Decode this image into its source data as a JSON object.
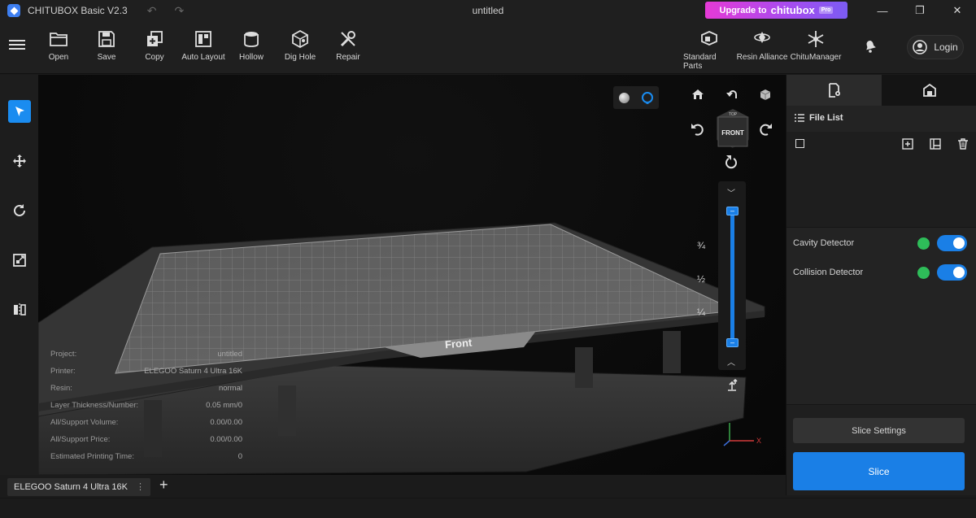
{
  "app": {
    "title": "CHITUBOX Basic V2.3",
    "window_title": "untitled"
  },
  "upgrade": {
    "prefix": "Upgrade to",
    "brand": "chitubox",
    "tag": "Pro"
  },
  "toolbar": {
    "open": "Open",
    "save": "Save",
    "copy": "Copy",
    "auto_layout": "Auto Layout",
    "hollow": "Hollow",
    "dig_hole": "Dig Hole",
    "repair": "Repair",
    "standard_parts": "Standard Parts",
    "resin_alliance": "Resin Alliance",
    "chitu_manager": "ChituManager",
    "login": "Login"
  },
  "left_tools": [
    "select",
    "move",
    "rotate",
    "scale",
    "mirror"
  ],
  "viewport": {
    "plate_label": "Front",
    "nav_cube_top": "TOP",
    "nav_cube_front": "FRONT",
    "slider_marks": [
      "¾",
      "½",
      "¼"
    ],
    "axis_x": "X"
  },
  "project_info": [
    {
      "label": "Project:",
      "value": "untitled"
    },
    {
      "label": "Printer:",
      "value": "ELEGOO Saturn 4 Ultra 16K"
    },
    {
      "label": "Resin:",
      "value": "normal"
    },
    {
      "label": "Layer Thickness/Number:",
      "value": "0.05 mm/0"
    },
    {
      "label": "All/Support Volume:",
      "value": "0.00/0.00"
    },
    {
      "label": "All/Support Price:",
      "value": "0.00/0.00"
    },
    {
      "label": "Estimated Printing Time:",
      "value": "0"
    }
  ],
  "right_panel": {
    "file_list": "File List",
    "cavity_detector": "Cavity Detector",
    "collision_detector": "Collision Detector",
    "cavity_enabled": true,
    "collision_enabled": true,
    "slice_settings": "Slice Settings",
    "slice": "Slice"
  },
  "tabs": {
    "printer_tab": "ELEGOO Saturn 4 Ultra 16K"
  },
  "colors": {
    "accent": "#1a7fe6",
    "upgrade_start": "#e53ad6",
    "upgrade_end": "#7b5cf2",
    "ok_green": "#2ebd59"
  }
}
